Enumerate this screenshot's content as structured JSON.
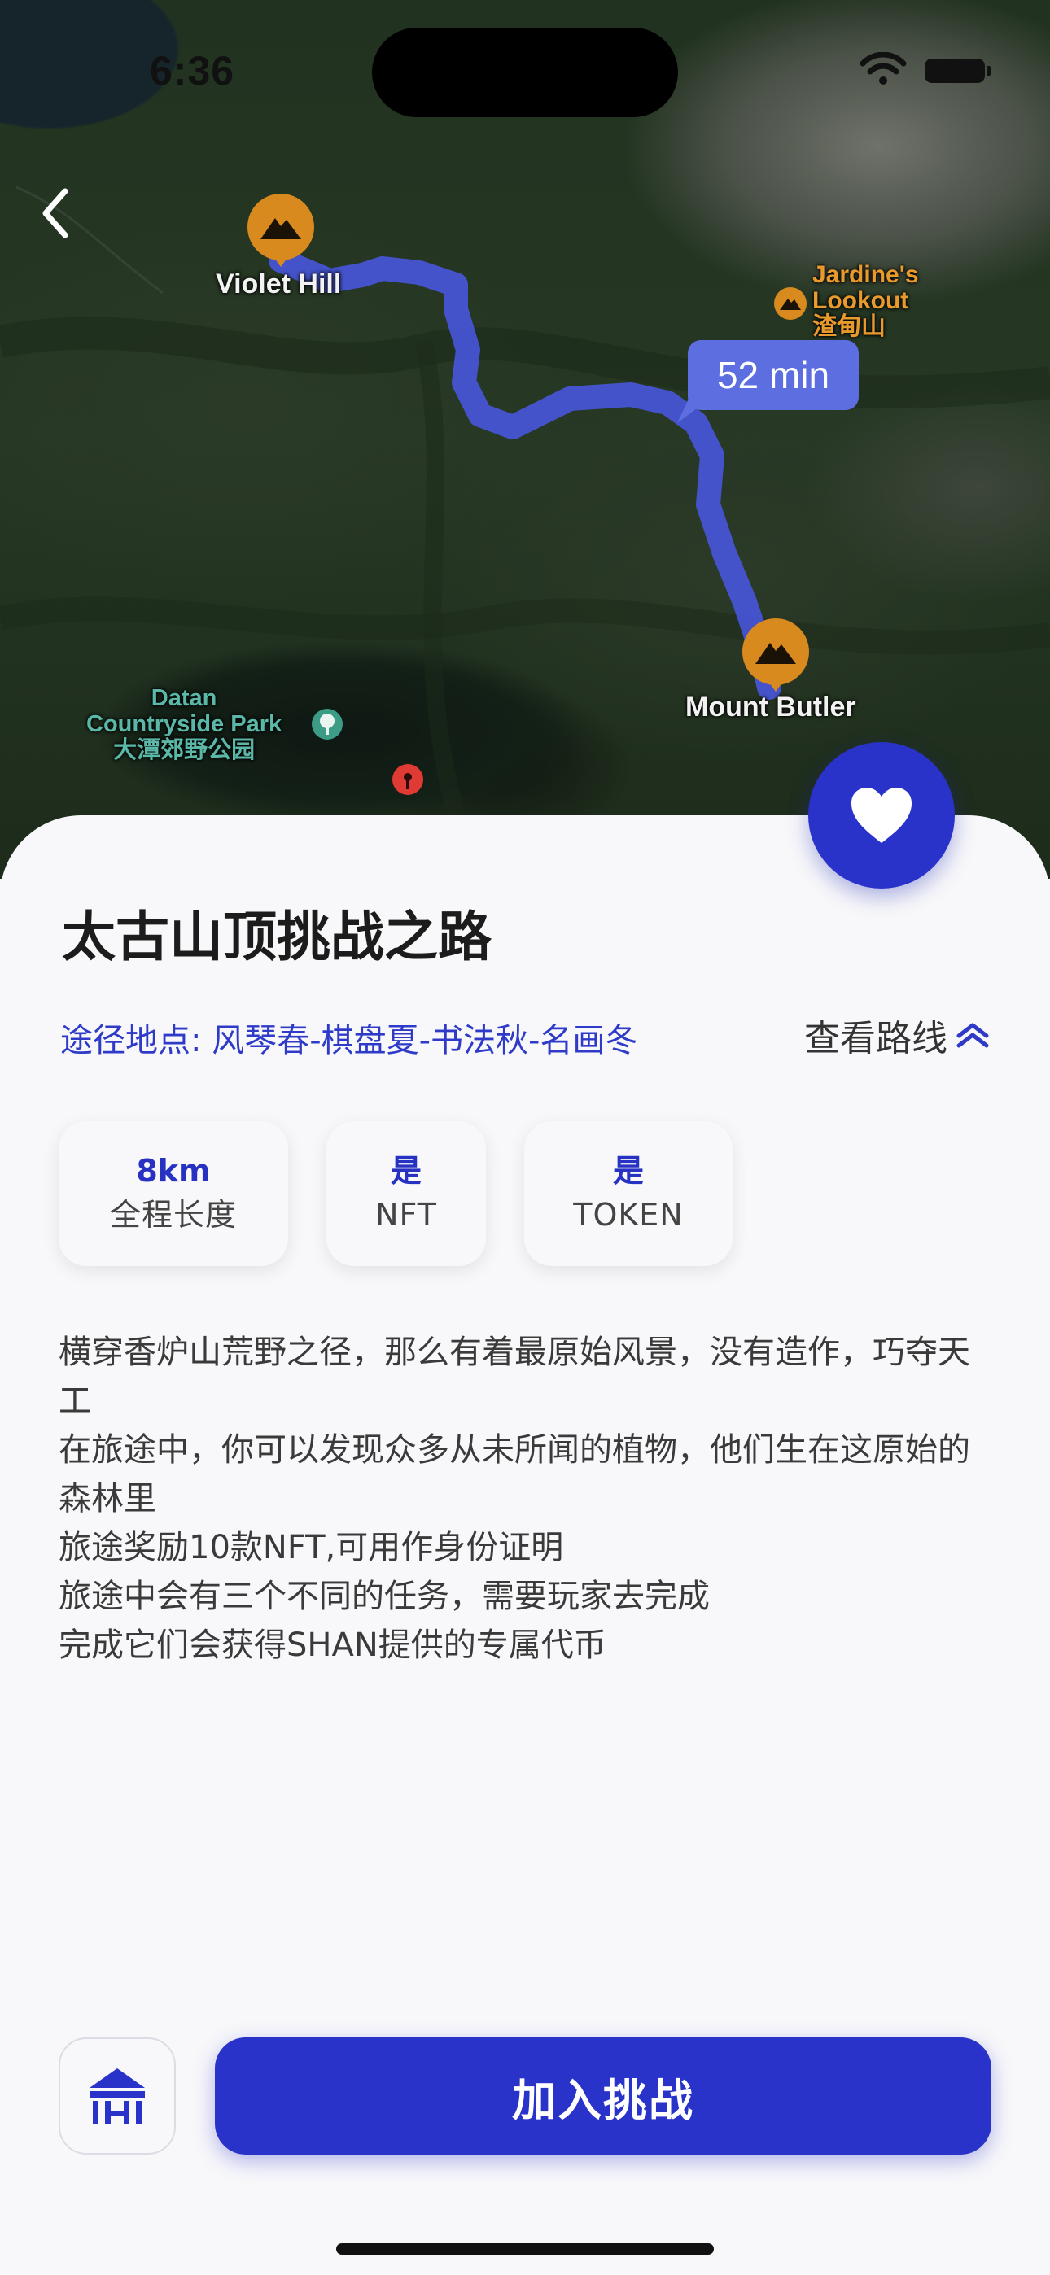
{
  "status_bar": {
    "time": "6:36"
  },
  "map": {
    "duration": "52 min",
    "places": {
      "start": "Violet Hill",
      "end": "Mount Butler",
      "poi_jardine_en": "Jardine's",
      "poi_jardine_en2": "Lookout",
      "poi_jardine_zh": "渣甸山",
      "park_en": "Datan",
      "park_en2": "Countryside Park",
      "park_zh": "大潭郊野公园"
    },
    "colors": {
      "route": "#4756d8",
      "pin": "#d98a1e",
      "bubble": "#5c6ee0"
    }
  },
  "route": {
    "title": "太古山顶挑战之路",
    "waypoints": "途径地点: 风琴春-棋盘夏-书法秋-名画冬",
    "view_route_label": "查看路线"
  },
  "stats": [
    {
      "value": "8km",
      "label": "全程长度"
    },
    {
      "value": "是",
      "label": "NFT"
    },
    {
      "value": "是",
      "label": "TOKEN"
    }
  ],
  "description": [
    "横穿香炉山荒野之径，那么有着最原始风景，没有造作，巧夺天工",
    "在旅途中，你可以发现众多从未所闻的植物，他们生在这原始的森林里",
    "旅途奖励10款NFT,可用作身份证明",
    "旅途中会有三个不同的任务，需要玩家去完成",
    "完成它们会获得SHAN提供的专属代币"
  ],
  "actions": {
    "join_label": "加入挑战"
  },
  "accent_color": "#2a33c9"
}
